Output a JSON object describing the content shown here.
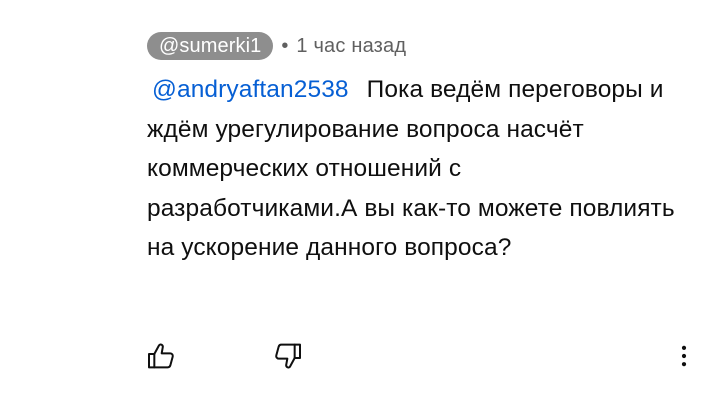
{
  "comment": {
    "author": "@sumerki1",
    "separator": "•",
    "timestamp": "1 час назад",
    "mention": "@andryaftan2538",
    "text": "Пока ведём переговоры и ждём урегулирование вопроса насчёт коммерческих отношений с разработчиками.А вы как-то можете повлиять на ускорение данного вопроса?"
  },
  "actions": {
    "like_icon": "thumbs-up-icon",
    "dislike_icon": "thumbs-down-icon",
    "menu_icon": "more-vertical-icon"
  },
  "colors": {
    "author_chip_bg": "#8e8e8e",
    "mention": "#065fd4",
    "meta_text": "#606060",
    "body_text": "#0f0f0f"
  }
}
